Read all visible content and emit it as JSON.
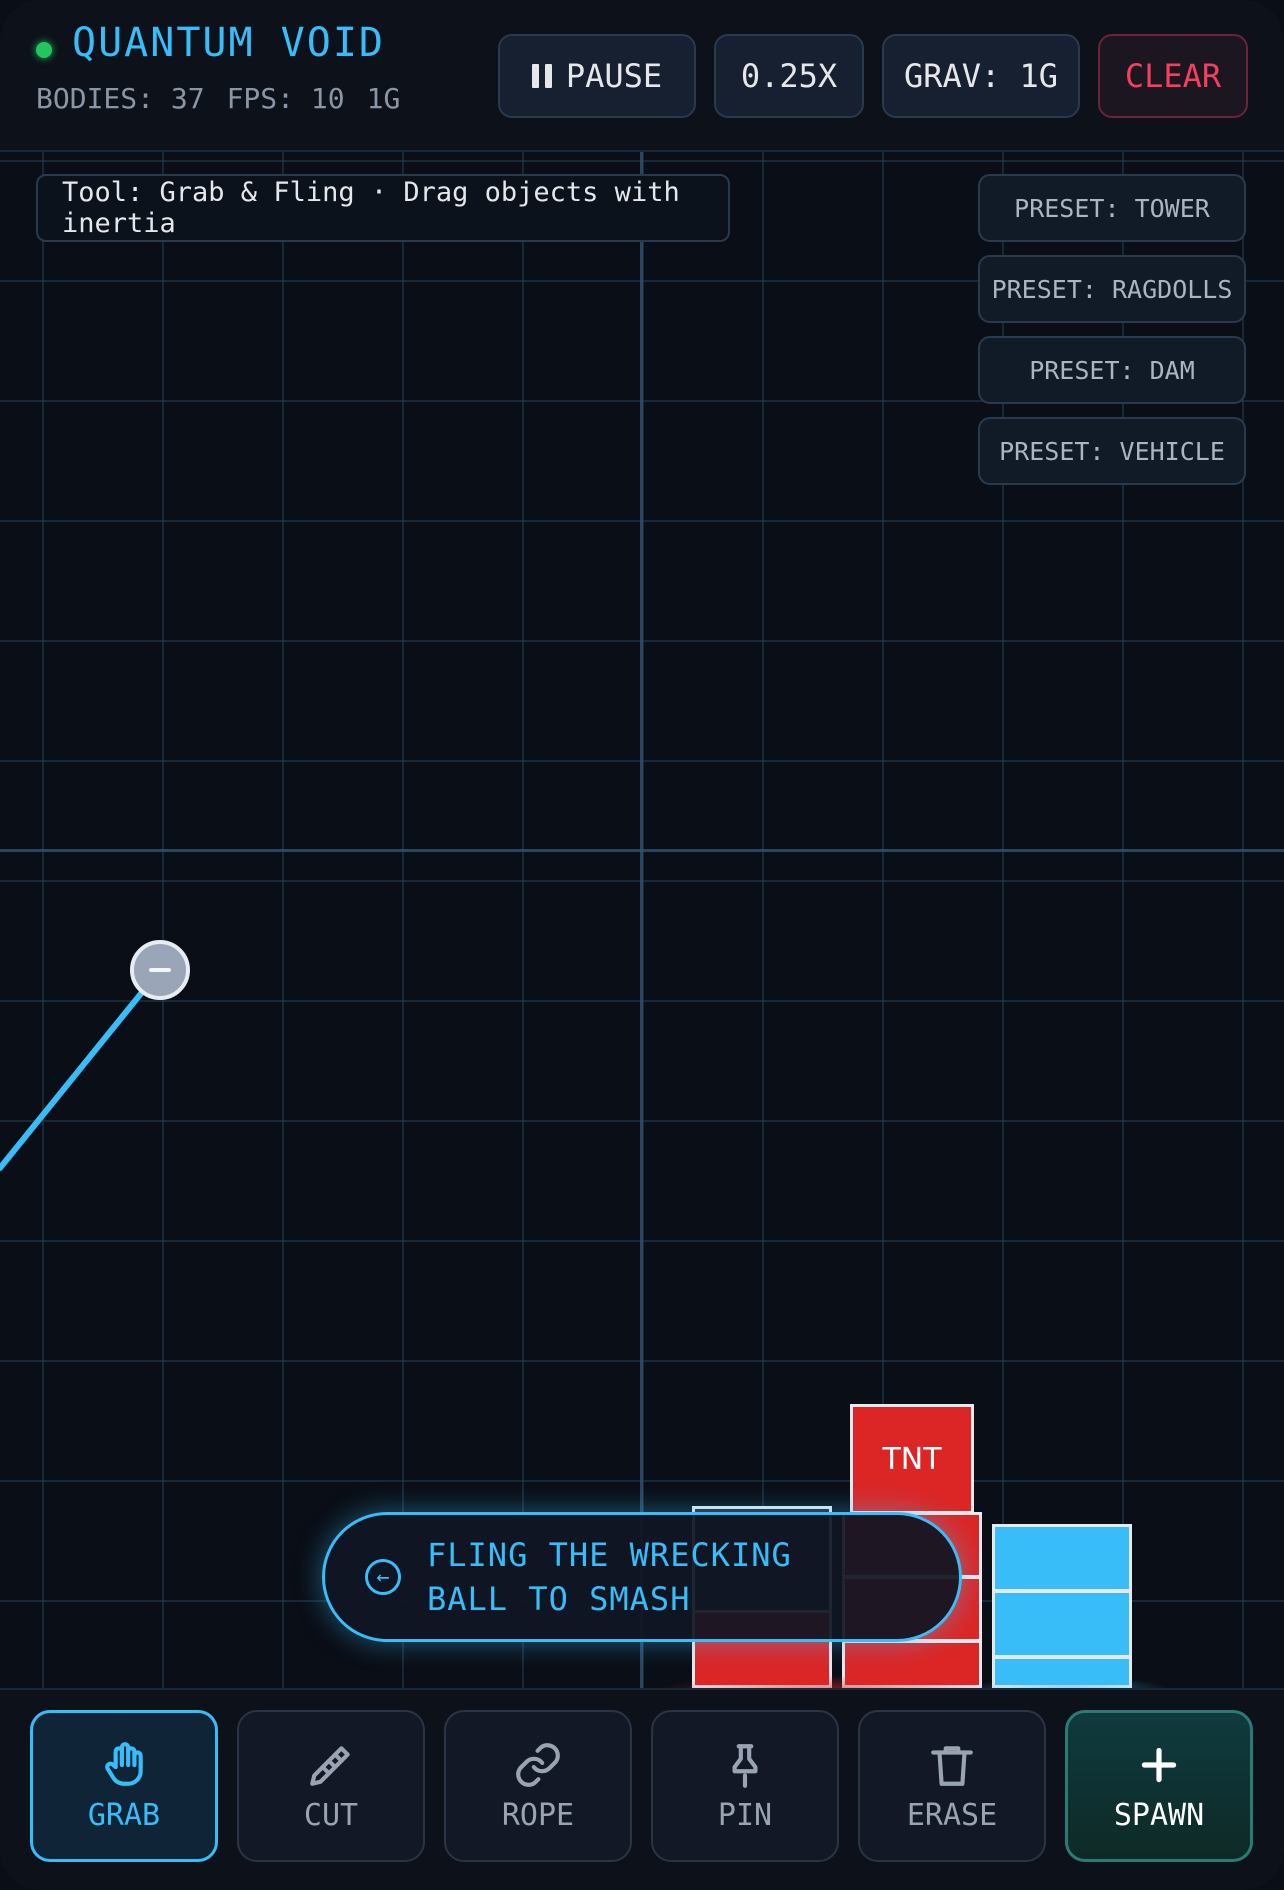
{
  "app": {
    "title": "QUANTUM VOID",
    "status_color": "#22c55e",
    "stats": {
      "bodies": "BODIES: 37",
      "fps": "FPS: 10",
      "gravity": "1G"
    }
  },
  "controls": {
    "pause_label": "PAUSE",
    "speed_label": "0.25X",
    "gravity_label": "GRAV: 1G",
    "clear_label": "CLEAR"
  },
  "tool_hint": "Tool: Grab & Fling · Drag objects with inertia",
  "presets": [
    "PRESET: TOWER",
    "PRESET: RAGDOLLS",
    "PRESET: DAM",
    "PRESET: VEHICLE"
  ],
  "world": {
    "tnt_label": "TNT",
    "hint": "FLING THE WRECKING BALL TO SMASH",
    "hint_icon": "arrow-left-circle-icon"
  },
  "toolbar": {
    "tools": [
      {
        "label": "GRAB",
        "icon": "hand-icon",
        "active": true
      },
      {
        "label": "CUT",
        "icon": "knife-icon",
        "active": false
      },
      {
        "label": "ROPE",
        "icon": "link-icon",
        "active": false
      },
      {
        "label": "PIN",
        "icon": "pin-icon",
        "active": false
      },
      {
        "label": "ERASE",
        "icon": "trash-icon",
        "active": false
      },
      {
        "label": "SPAWN",
        "icon": "plus-icon",
        "active": false
      }
    ]
  },
  "colors": {
    "accent": "#38bdf8",
    "danger": "#f43f5e",
    "tnt": "#dc2626",
    "spawn": "#0f3a3f"
  }
}
